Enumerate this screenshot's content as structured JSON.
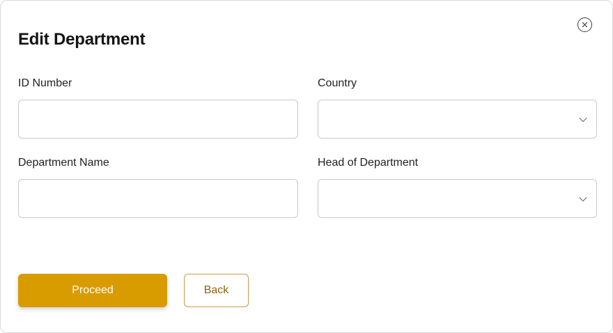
{
  "dialog": {
    "title": "Edit Department",
    "close_icon": "close-icon"
  },
  "form": {
    "id_number": {
      "label": "ID Number",
      "value": "",
      "placeholder": ""
    },
    "country": {
      "label": "Country",
      "value": "",
      "icon": "chevron-down-icon"
    },
    "department_name": {
      "label": "Department Name",
      "value": "",
      "placeholder": ""
    },
    "head_of_department": {
      "label": "Head of Department",
      "value": "",
      "icon": "chevron-down-icon"
    }
  },
  "actions": {
    "proceed_label": "Proceed",
    "back_label": "Back"
  },
  "colors": {
    "accent": "#d89b00",
    "back_border": "#c79a45",
    "back_text": "#8a6508",
    "input_border": "#c9c9c9"
  }
}
